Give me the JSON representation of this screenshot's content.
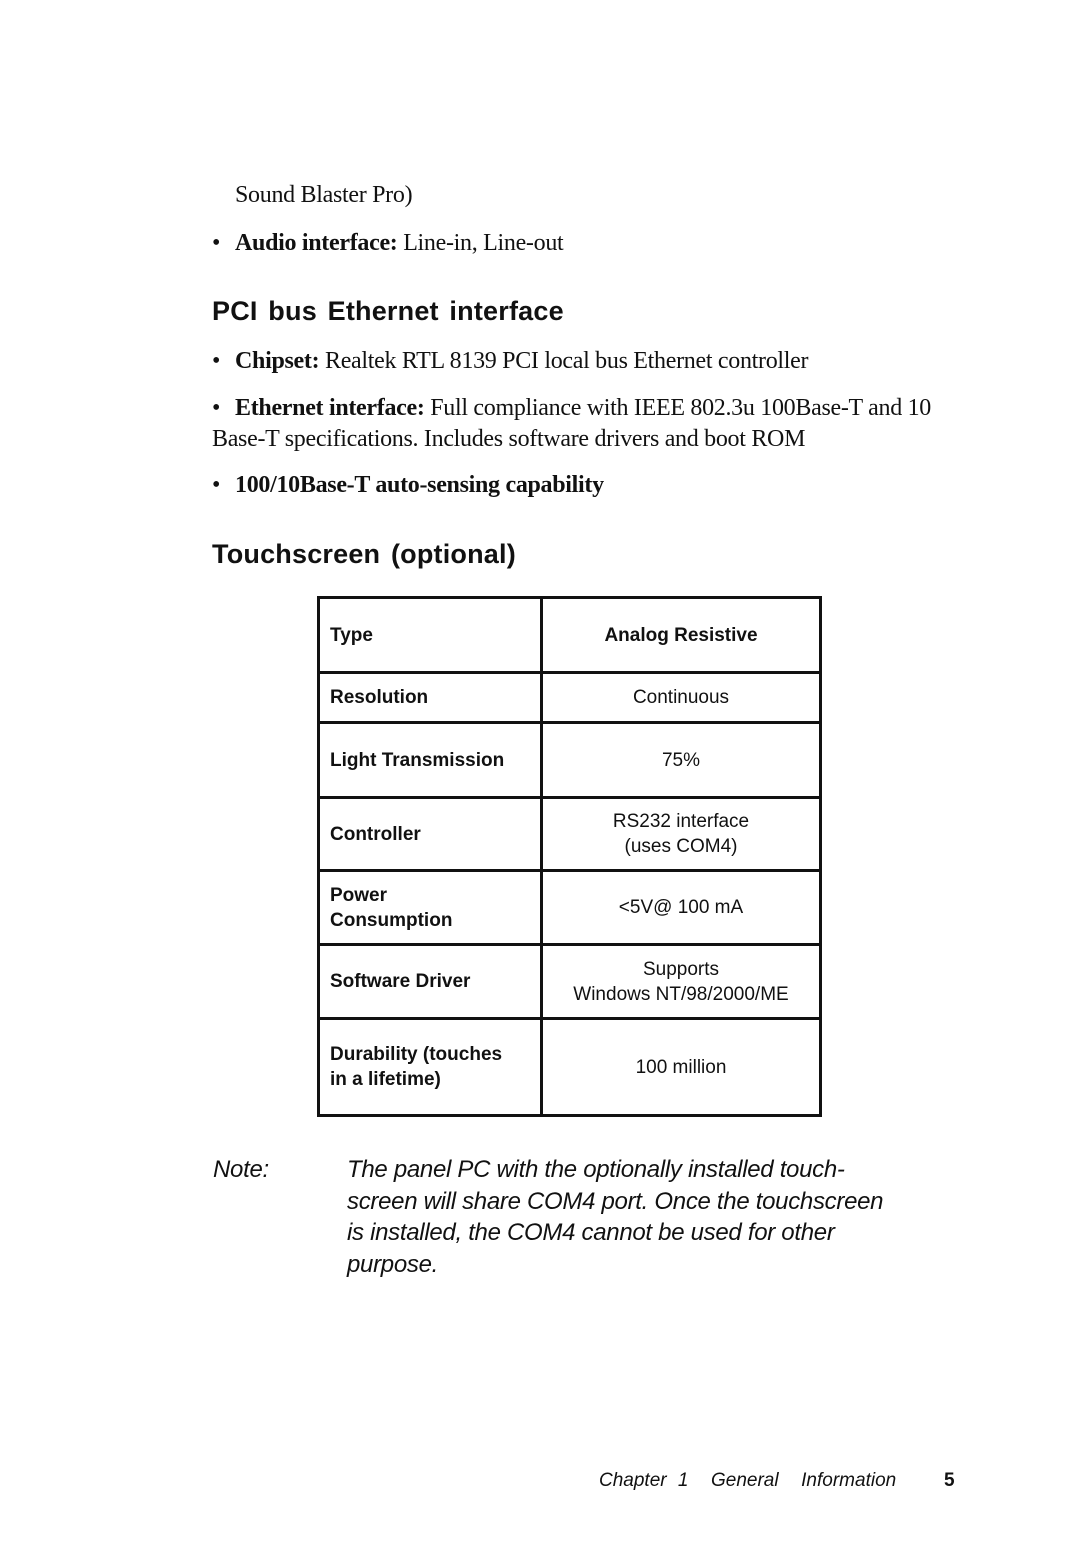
{
  "continuation_text": "Sound Blaster Pro)",
  "audio_bullet": {
    "label": "Audio interface:",
    "text": " Line-in, Line-out"
  },
  "sections": {
    "ethernet": {
      "heading": "PCI bus Ethernet interface",
      "bullets": [
        {
          "label": "Chipset:",
          "text": " Realtek RTL 8139 PCI local bus Ethernet controller"
        },
        {
          "label": "Ethernet interface:",
          "text": " Full compliance with IEEE 802.3u 100Base-T and 10 Base-T specifications. Includes software drivers and boot ROM"
        },
        {
          "label": "100/10Base-T auto-sensing capability",
          "text": ""
        }
      ]
    },
    "touchscreen": {
      "heading": "Touchscreen (optional)",
      "table": {
        "rows": [
          {
            "label": "Type",
            "value_lines": [
              "Analog Resistive"
            ]
          },
          {
            "label": "Resolution",
            "value_lines": [
              "Continuous"
            ]
          },
          {
            "label": "Light Transmission",
            "value_lines": [
              "75%"
            ]
          },
          {
            "label": "Controller",
            "value_lines": [
              "RS232 interface",
              "(uses COM4)"
            ]
          },
          {
            "label_lines": [
              "Power",
              "Consumption"
            ],
            "value_lines": [
              "<5V@ 100 mA"
            ]
          },
          {
            "label": "Software Driver",
            "value_lines": [
              "Supports",
              "Windows NT/98/2000/ME"
            ]
          },
          {
            "label_lines": [
              "Durability (touches",
              "in a lifetime)"
            ],
            "value_lines": [
              "100 million"
            ]
          }
        ]
      }
    }
  },
  "note": {
    "label": "Note:",
    "lines": [
      "The panel PC with the optionally installed touch-",
      "screen will share COM4 port. Once the touchscreen",
      "is installed, the COM4 cannot be used for other",
      "purpose."
    ]
  },
  "footer": {
    "chapter": "Chapter 1  General  Information",
    "page_number": "5"
  }
}
